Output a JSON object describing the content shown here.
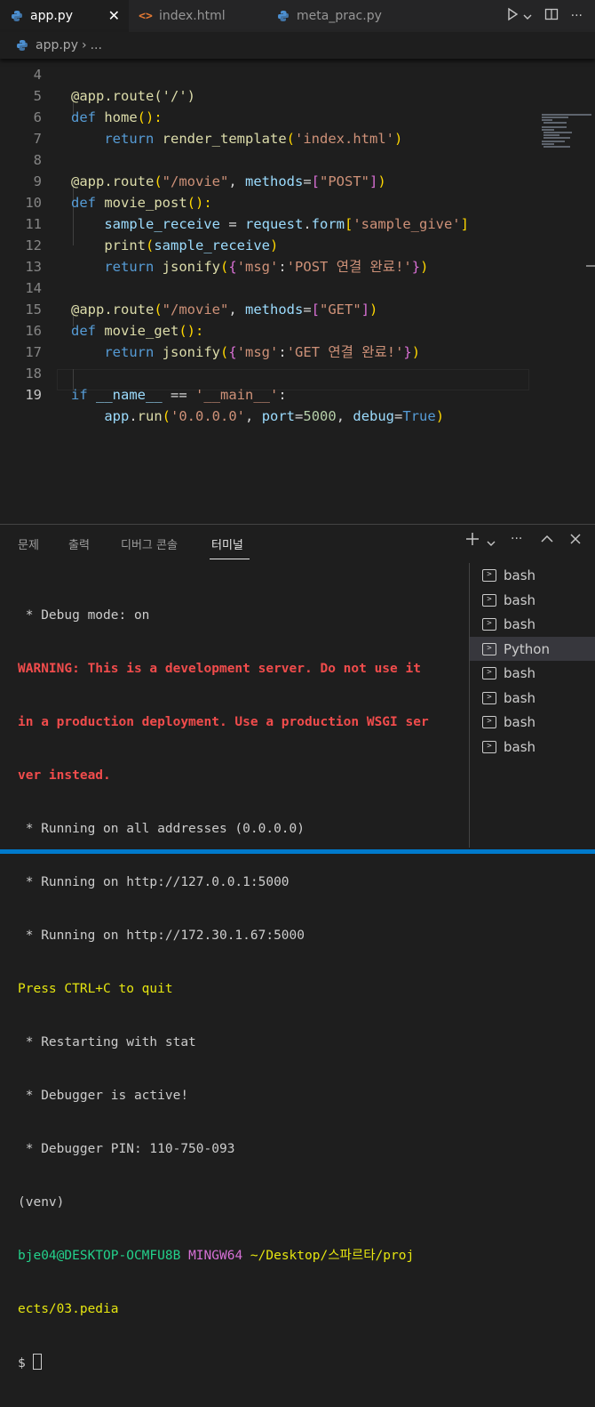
{
  "tabs": [
    {
      "label": "app.py",
      "icon": "python-file-icon",
      "active": true
    },
    {
      "label": "index.html",
      "icon": "html-file-icon",
      "active": false
    },
    {
      "label": "meta_prac.py",
      "icon": "python-file-icon",
      "active": false
    }
  ],
  "tab_close_glyph": "✕",
  "breadcrumb": {
    "file": "app.py",
    "separator": "›",
    "more": "..."
  },
  "code_lines": [
    {
      "n": "4"
    },
    {
      "n": "5"
    },
    {
      "n": "6"
    },
    {
      "n": "7"
    },
    {
      "n": "8"
    },
    {
      "n": "9"
    },
    {
      "n": "10"
    },
    {
      "n": "11"
    },
    {
      "n": "12"
    },
    {
      "n": "13"
    },
    {
      "n": "14"
    },
    {
      "n": "15"
    },
    {
      "n": "16"
    },
    {
      "n": "17"
    },
    {
      "n": "18"
    },
    {
      "n": "19"
    }
  ],
  "code": {
    "l4_decorator": "@app.route('/')",
    "l5_kw": "def",
    "l5_fn": "home",
    "l5_rest": "():",
    "l6_kw": "return",
    "l6_fn": "render_template",
    "l6_str": "'index.html'",
    "l8_dec": "@app.route",
    "l8_str": "\"/movie\"",
    "l8_param": "methods",
    "l8_list_str": "\"POST\"",
    "l9_kw": "def",
    "l9_fn": "movie_post",
    "l9_rest": "():",
    "l10_var": "sample_receive",
    "l10_obj": "request",
    "l10_attr": "form",
    "l10_key": "'sample_give'",
    "l11_fn": "print",
    "l11_arg": "sample_receive",
    "l12_kw": "return",
    "l12_fn": "jsonify",
    "l12_key": "'msg'",
    "l12_val": "'POST 연결 완료!'",
    "l14_dec": "@app.route",
    "l14_str": "\"/movie\"",
    "l14_param": "methods",
    "l14_list_str": "\"GET\"",
    "l15_kw": "def",
    "l15_fn": "movie_get",
    "l15_rest": "():",
    "l16_kw": "return",
    "l16_fn": "jsonify",
    "l16_key": "'msg'",
    "l16_val": "'GET 연결 완료!'",
    "l18_kw": "if",
    "l18_name": "__name__",
    "l18_op": "==",
    "l18_str": "'__main__'",
    "l19_obj": "app",
    "l19_fn": "run",
    "l19_host": "'0.0.0.0'",
    "l19_port_k": "port",
    "l19_port_v": "5000",
    "l19_debug_k": "debug",
    "l19_debug_v": "True"
  },
  "panel_tabs": [
    "문제",
    "출력",
    "디버그 콘솔",
    "터미널"
  ],
  "terminal": {
    "l1": " * Debug mode: on",
    "l2": "WARNING: This is a development server. Do not use it",
    "l3": "in a production deployment. Use a production WSGI ser",
    "l4": "ver instead.",
    "l5": " * Running on all addresses (0.0.0.0)",
    "l6": " * Running on http://127.0.0.1:5000",
    "l7": " * Running on http://172.30.1.67:5000",
    "l8": "Press CTRL+C to quit",
    "l9": " * Restarting with stat",
    "l10": " * Debugger is active!",
    "l11": " * Debugger PIN: 110-750-093",
    "l12": "(venv)",
    "prompt_user": "bje04@DESKTOP-OCMFU8B",
    "prompt_env": "MINGW64",
    "prompt_path_1": "~/Desktop/스파르타/proj",
    "prompt_path_2": "ects/03.pedia",
    "prompt_symbol": "$"
  },
  "terminal_list": [
    {
      "label": "bash",
      "selected": false
    },
    {
      "label": "bash",
      "selected": false
    },
    {
      "label": "bash",
      "selected": false
    },
    {
      "label": "Python",
      "selected": true
    },
    {
      "label": "bash",
      "selected": false
    },
    {
      "label": "bash",
      "selected": false
    },
    {
      "label": "bash",
      "selected": false
    },
    {
      "label": "bash",
      "selected": false
    }
  ],
  "colors": {
    "accent": "#007acc",
    "editor_bg": "#1e1e1e",
    "warning_red": "#f14c4c"
  }
}
